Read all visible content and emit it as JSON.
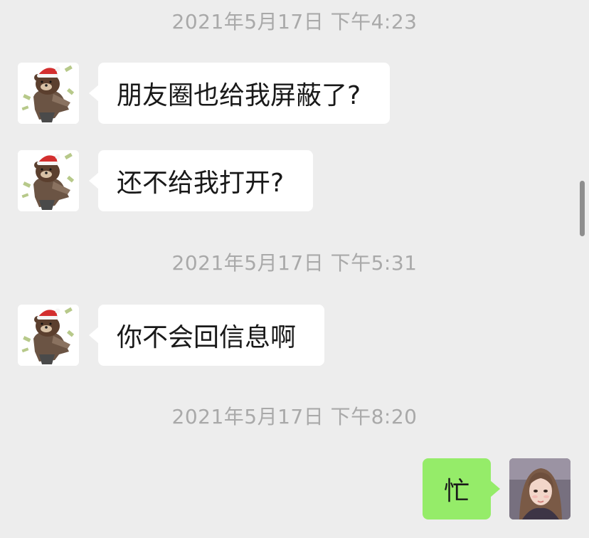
{
  "chat": {
    "messages": [
      {
        "time": "2021年5月17日 下午4:23"
      },
      {
        "text": "朋友圈也给我屏蔽了?"
      },
      {
        "text": "还不给我打开?"
      },
      {
        "time": "2021年5月17日 下午5:31"
      },
      {
        "text": "你不会回信息啊"
      },
      {
        "time": "2021年5月17日 下午8:20"
      },
      {
        "text": "忙"
      }
    ]
  },
  "icons": {
    "contact_avatar": "brown-bear-santa-hat-avatar",
    "self_avatar": "girl-portrait-avatar"
  },
  "colors": {
    "background": "#ededed",
    "incoming_bubble": "#ffffff",
    "outgoing_bubble": "#95ec69",
    "timestamp_text": "#a9a9a9",
    "message_text": "#191919"
  }
}
